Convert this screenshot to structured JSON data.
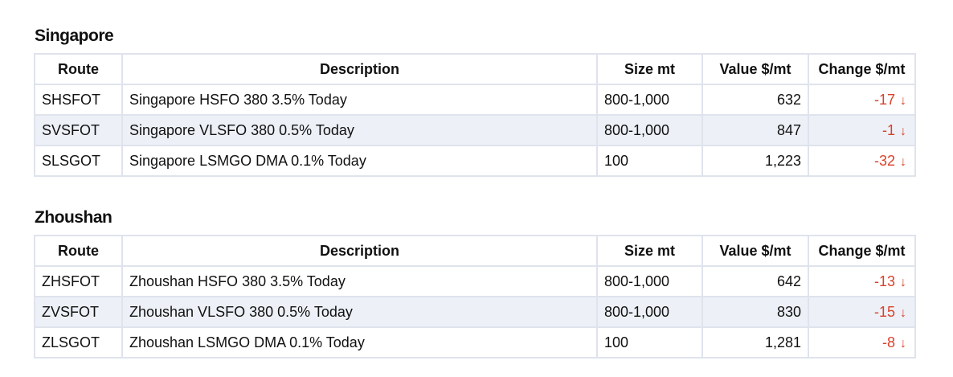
{
  "columns": {
    "route": "Route",
    "description": "Description",
    "size": "Size mt",
    "value": "Value $/mt",
    "change": "Change $/mt"
  },
  "colors": {
    "negative": "#d9412b",
    "border": "#dfe3ec",
    "row_stripe": "#edf1f7"
  },
  "sections": [
    {
      "title": "Singapore",
      "rows": [
        {
          "route": "SHSFOT",
          "description": "Singapore HSFO 380 3.5% Today",
          "size": "800-1,000",
          "value": "632",
          "change": "-17",
          "direction": "down-arrow-icon"
        },
        {
          "route": "SVSFOT",
          "description": "Singapore VLSFO 380 0.5% Today",
          "size": "800-1,000",
          "value": "847",
          "change": "-1",
          "direction": "down-arrow-icon"
        },
        {
          "route": "SLSGOT",
          "description": "Singapore LSMGO DMA 0.1% Today",
          "size": "100",
          "value": "1,223",
          "change": "-32",
          "direction": "down-arrow-icon"
        }
      ]
    },
    {
      "title": "Zhoushan",
      "rows": [
        {
          "route": "ZHSFOT",
          "description": "Zhoushan HSFO 380 3.5% Today",
          "size": "800-1,000",
          "value": "642",
          "change": "-13",
          "direction": "down-arrow-icon"
        },
        {
          "route": "ZVSFOT",
          "description": "Zhoushan VLSFO 380 0.5% Today",
          "size": "800-1,000",
          "value": "830",
          "change": "-15",
          "direction": "down-arrow-icon"
        },
        {
          "route": "ZLSGOT",
          "description": "Zhoushan LSMGO DMA 0.1% Today",
          "size": "100",
          "value": "1,281",
          "change": "-8",
          "direction": "down-arrow-icon"
        }
      ]
    }
  ]
}
